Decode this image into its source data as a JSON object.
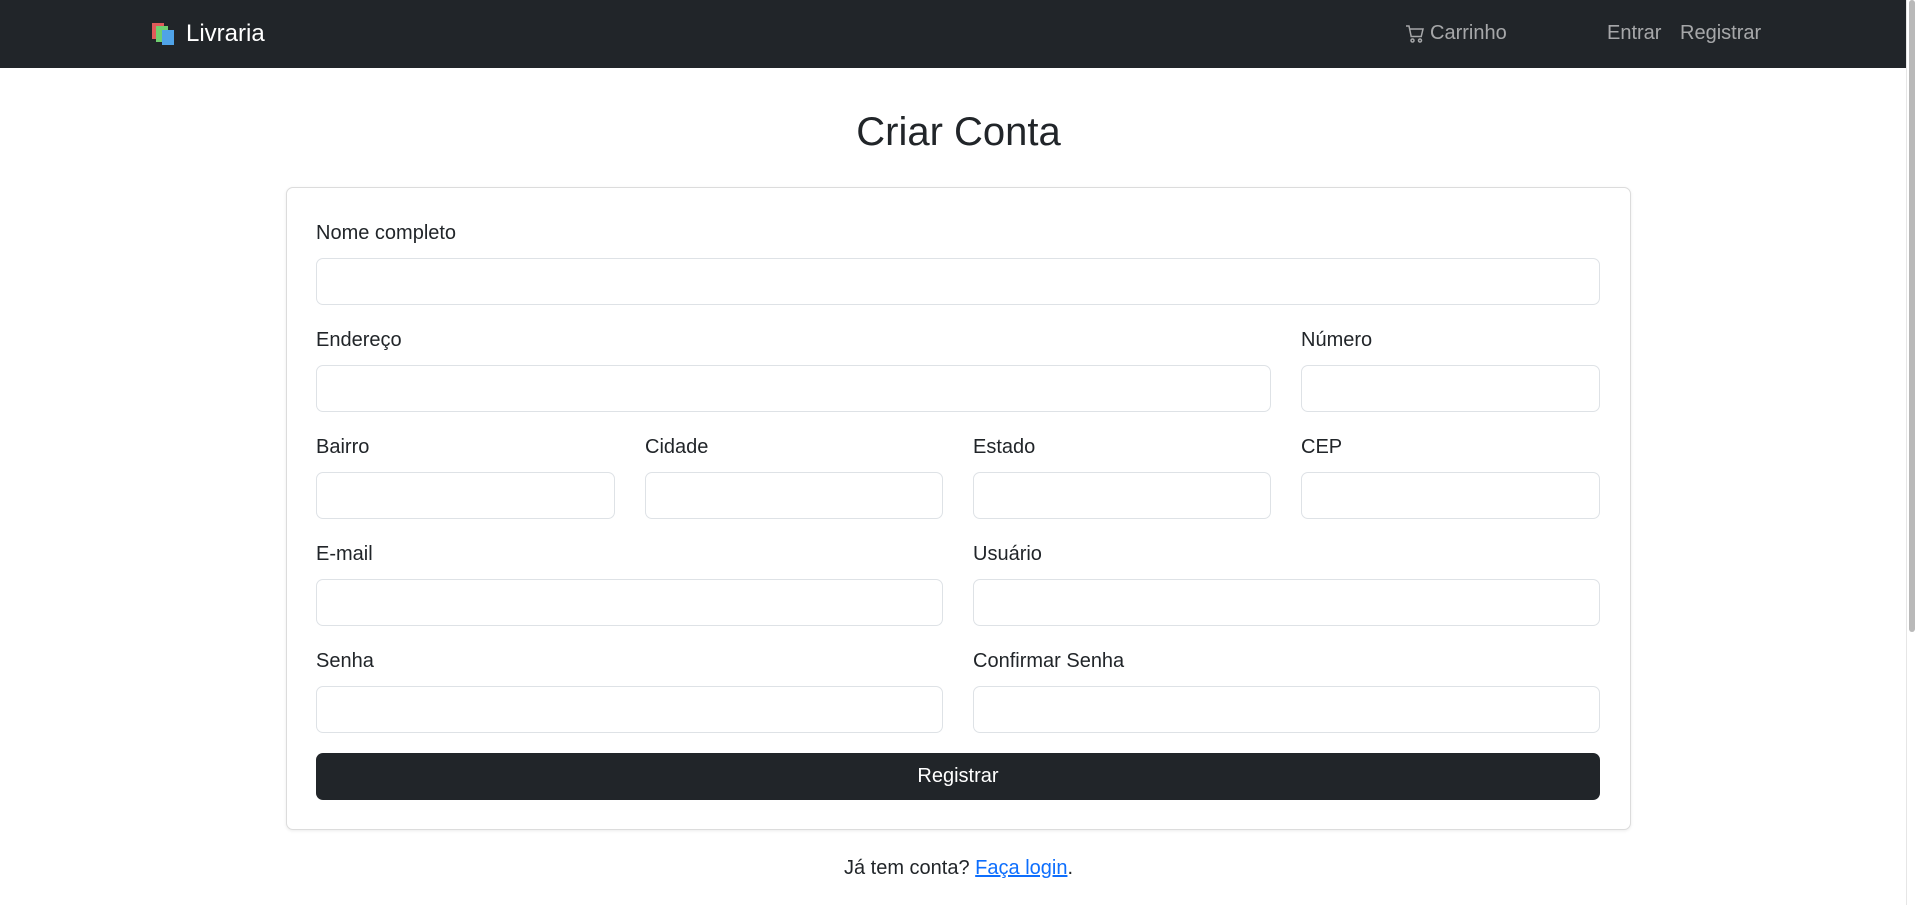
{
  "navbar": {
    "brand": "Livraria",
    "brand_icon": "books-icon",
    "cart_label": "Carrinho",
    "cart_icon": "cart-icon",
    "login_label": "Entrar",
    "register_label": "Registrar",
    "background": "#212529"
  },
  "page": {
    "title": "Criar Conta"
  },
  "form": {
    "full_name": {
      "label": "Nome completo",
      "value": ""
    },
    "address": {
      "label": "Endereço",
      "value": ""
    },
    "number": {
      "label": "Número",
      "value": ""
    },
    "neighborhood": {
      "label": "Bairro",
      "value": ""
    },
    "city": {
      "label": "Cidade",
      "value": ""
    },
    "state": {
      "label": "Estado",
      "value": ""
    },
    "zip": {
      "label": "CEP",
      "value": ""
    },
    "email": {
      "label": "E-mail",
      "value": ""
    },
    "username": {
      "label": "Usuário",
      "value": ""
    },
    "password": {
      "label": "Senha",
      "value": ""
    },
    "confirm_password": {
      "label": "Confirmar Senha",
      "value": ""
    },
    "submit_label": "Registrar"
  },
  "footer": {
    "prompt": "Já tem conta?",
    "link": "Faça login",
    "suffix": ".",
    "link_color": "#0d6efd"
  }
}
